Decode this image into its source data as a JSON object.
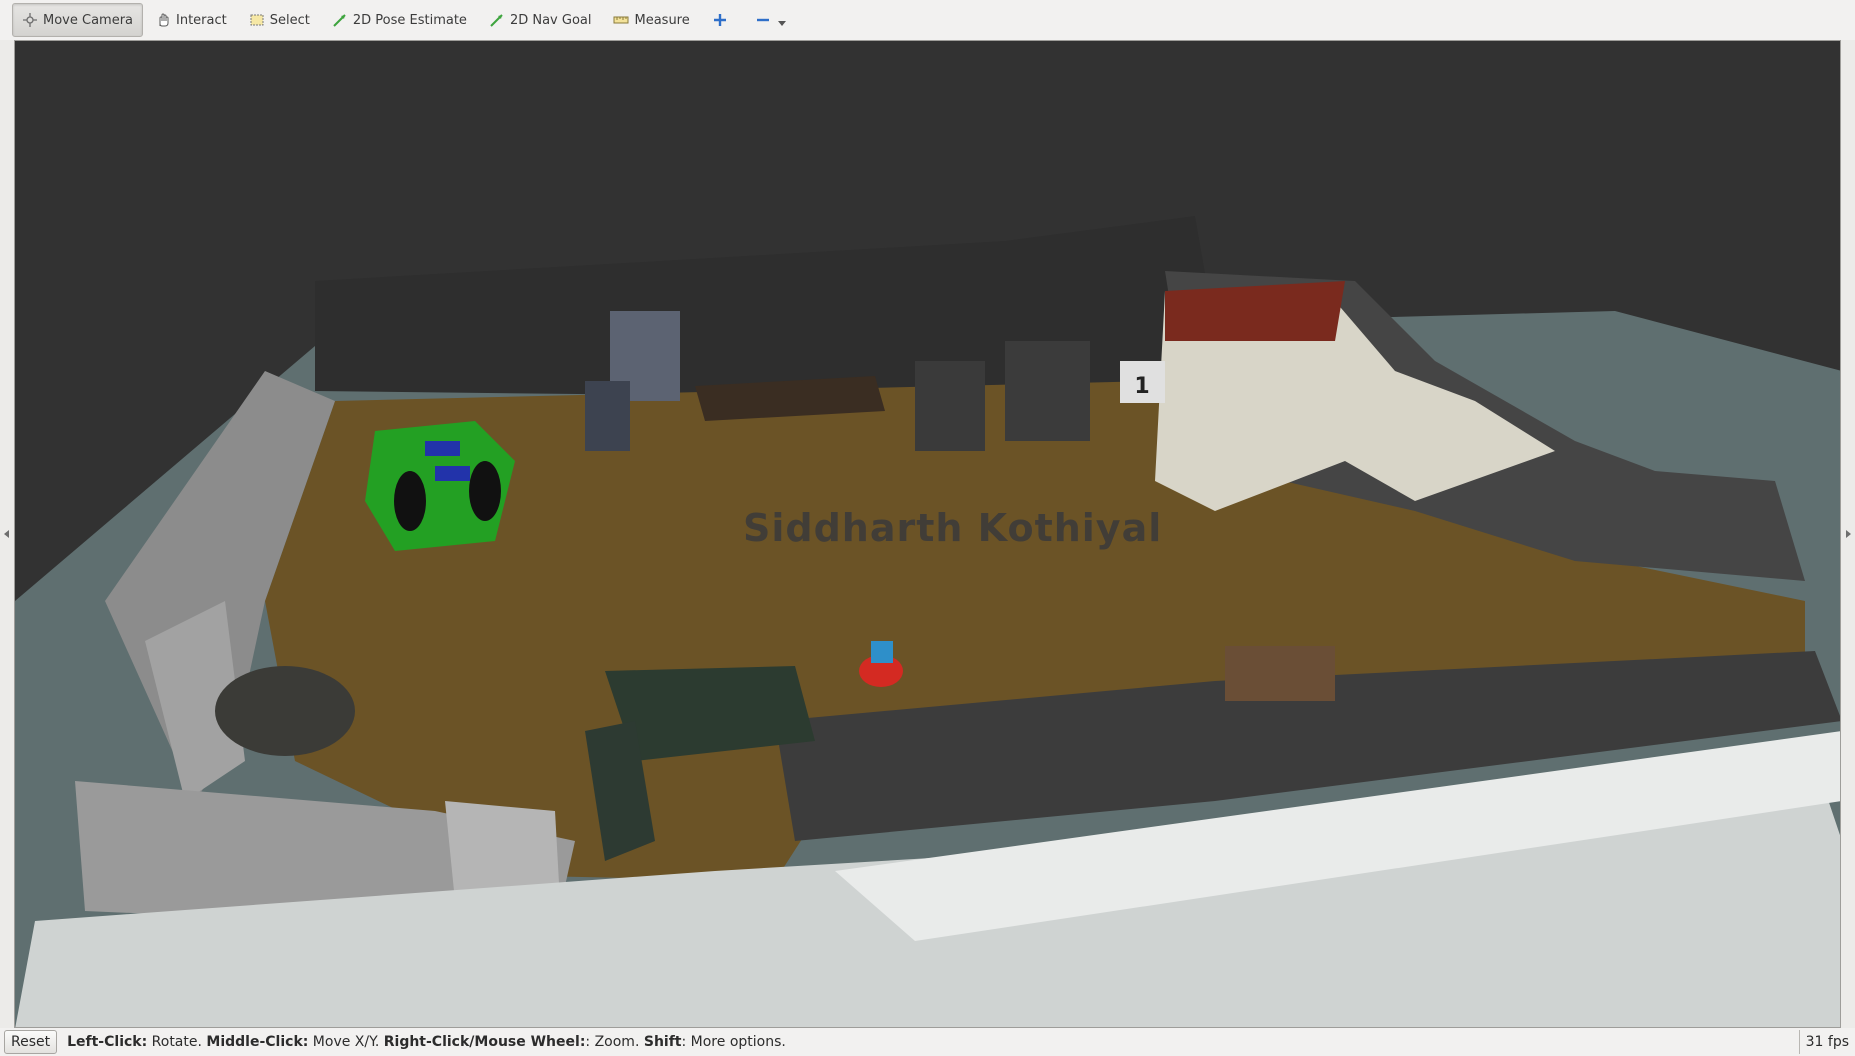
{
  "toolbar": {
    "tools": [
      {
        "label": "Move Camera",
        "icon": "move-camera-icon",
        "active": true
      },
      {
        "label": "Interact",
        "icon": "hand-icon"
      },
      {
        "label": "Select",
        "icon": "select-box-icon"
      },
      {
        "label": "2D Pose Estimate",
        "icon": "green-arrow-icon"
      },
      {
        "label": "2D Nav Goal",
        "icon": "green-arrow-icon"
      },
      {
        "label": "Measure",
        "icon": "ruler-icon"
      }
    ],
    "add_tool_icon": "plus-icon",
    "remove_tool_icon": "minus-icon"
  },
  "viewport": {
    "overlay_text": "Siddharth Kothiyal",
    "colors": {
      "background": "#323232",
      "floor": "#6b5326",
      "ground": "#5f6f70"
    }
  },
  "status": {
    "reset_label": "Reset",
    "hint_segments": [
      {
        "bold": "Left-Click:",
        "text": " Rotate. "
      },
      {
        "bold": "Middle-Click:",
        "text": " Move X/Y. "
      },
      {
        "bold": "Right-Click/Mouse Wheel:",
        "text": ": Zoom. "
      },
      {
        "bold": "Shift",
        "text": ": More options."
      }
    ],
    "fps": "31 fps"
  }
}
